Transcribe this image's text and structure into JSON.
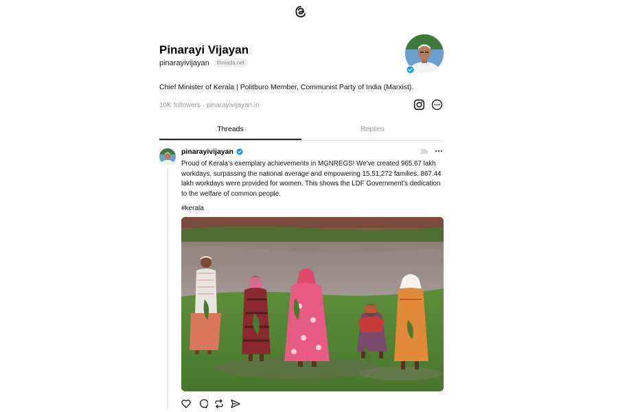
{
  "app": {
    "logo_icon": "threads-logo-icon"
  },
  "profile": {
    "name": "Pinarayi Vijayan",
    "handle": "pinarayivijayan",
    "domain_badge": "threads.net",
    "bio": "Chief Minister of Kerala | Politburo Member, Communist Party of India (Marxist).",
    "followers": "10K followers",
    "separator": "·",
    "website": "pinarayivijayan.in",
    "verified_color": "#1d9bf0"
  },
  "tabs": [
    {
      "label": "Threads",
      "active": true
    },
    {
      "label": "Replies",
      "active": false
    }
  ],
  "post": {
    "author": "pinarayivijayan",
    "time": "3h",
    "text": "Proud of Kerala's exemplary achievements in MGNREGS! We've created 965.67 lakh workdays, surpassing the national average and empowering 15,51,272 families. 867.44 lakh workdays were provided for women. This shows the LDF Government's dedication to the welfare of common people.",
    "hashtag": "#kerala",
    "actions": [
      "heart-icon",
      "comment-icon",
      "repost-icon",
      "share-icon"
    ]
  }
}
